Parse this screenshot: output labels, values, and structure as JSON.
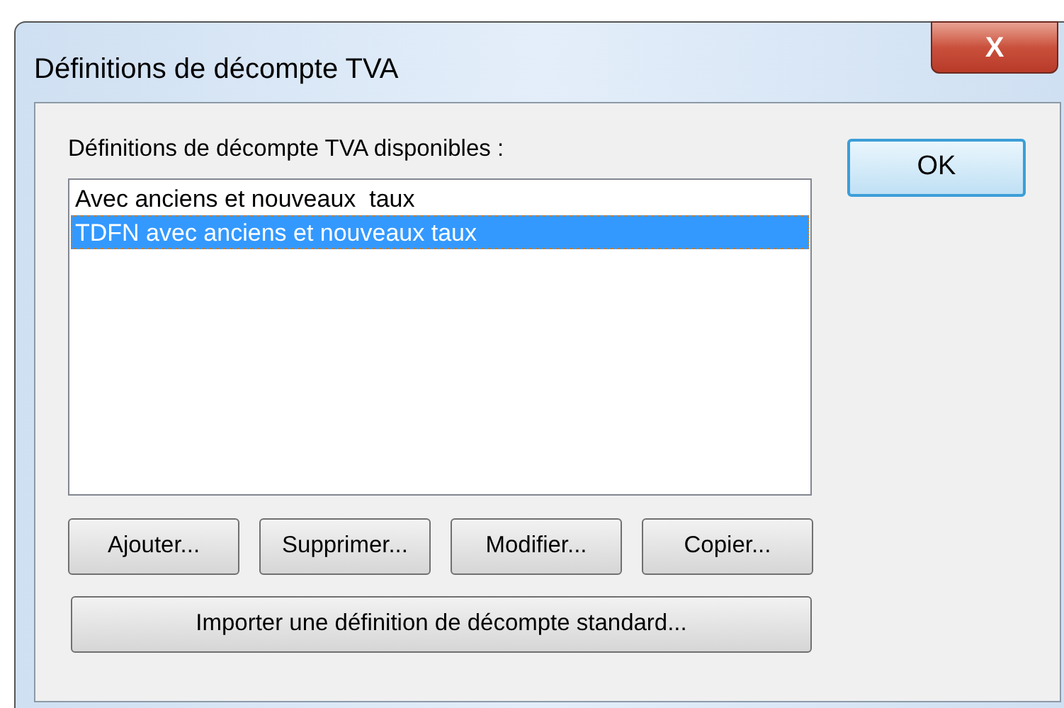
{
  "window": {
    "title": "Définitions de décompte TVA",
    "close_label": "X"
  },
  "list_label": "Définitions de décompte TVA disponibles :",
  "list_items": [
    {
      "label": "Avec anciens et nouveaux  taux",
      "selected": false
    },
    {
      "label": "TDFN avec anciens et nouveaux taux",
      "selected": true
    }
  ],
  "ok_button": "OK",
  "buttons": [
    "Ajouter...",
    "Supprimer...",
    "Modifier...",
    "Copier..."
  ],
  "import_button": "Importer une définition de décompte standard..."
}
